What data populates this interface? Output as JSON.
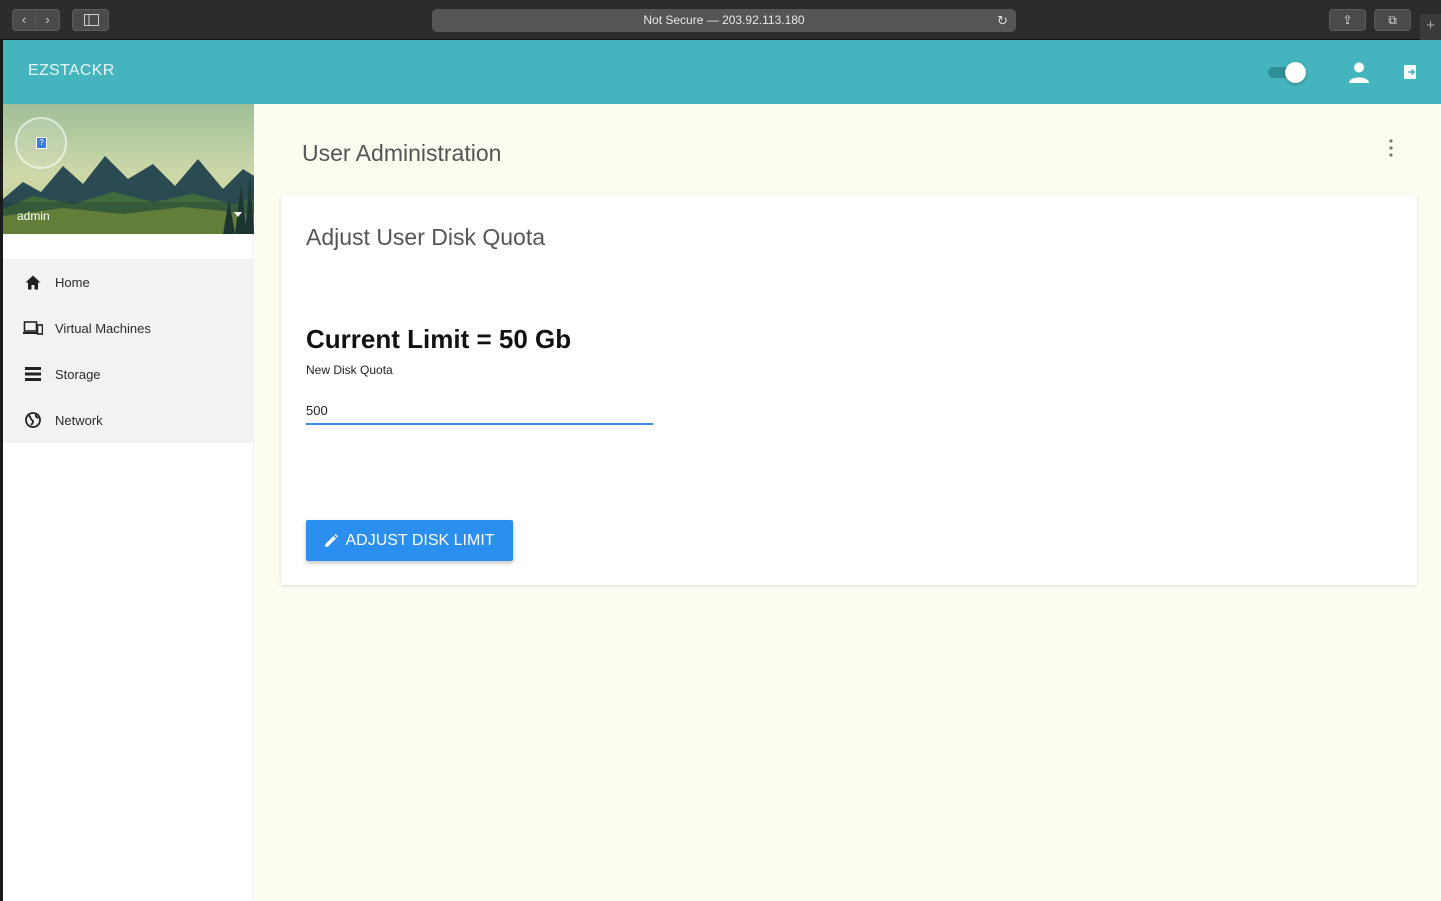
{
  "browser": {
    "address": "Not Secure — 203.92.113.180",
    "back_glyph": "‹",
    "forward_glyph": "›",
    "reload_glyph": "↻",
    "share_glyph": "⇪",
    "tabs_glyph": "⧉",
    "newtab_glyph": "+"
  },
  "header": {
    "brand": "EZSTACKR",
    "theme_toggle_on": true,
    "accent_color": "#44b5be",
    "icons": [
      "toggle-icon",
      "user-icon",
      "logout-icon"
    ]
  },
  "sidebar": {
    "profile": {
      "name": "admin",
      "avatar_icon": "?"
    },
    "items": [
      {
        "label": "Home",
        "icon": "home-icon"
      },
      {
        "label": "Virtual Machines",
        "icon": "devices-icon"
      },
      {
        "label": "Storage",
        "icon": "storage-icon"
      },
      {
        "label": "Network",
        "icon": "globe-icon"
      }
    ]
  },
  "main": {
    "page_title": "User Administration",
    "card": {
      "title": "Adjust User Disk Quota",
      "current_limit": "Current Limit = 50 Gb",
      "field_label": "New Disk Quota",
      "field_value": "500",
      "button_label": "ADJUST DISK LIMIT",
      "button_color": "#2b8ff0"
    }
  }
}
